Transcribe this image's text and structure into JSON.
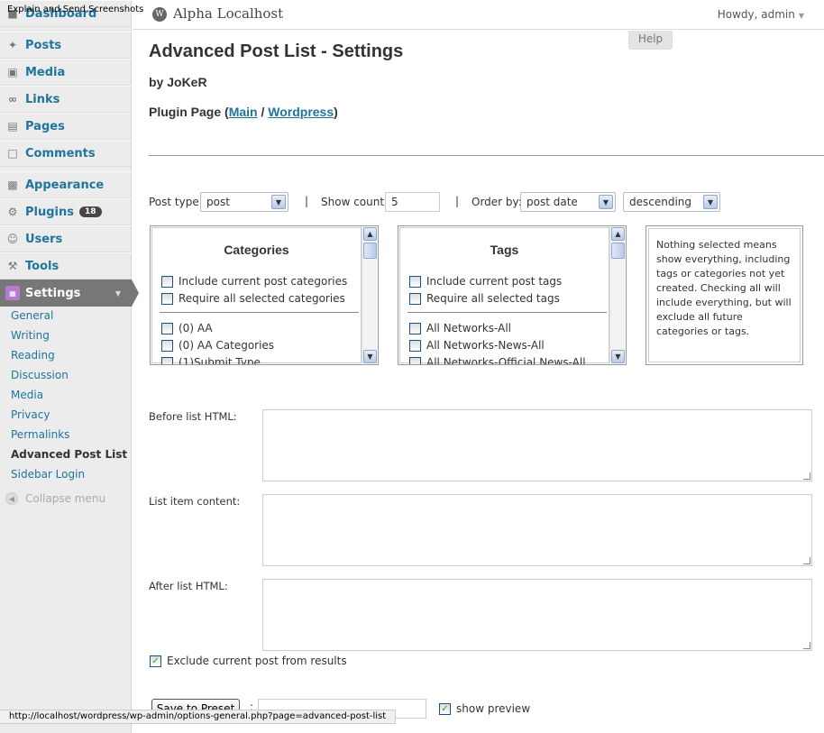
{
  "window": {
    "tooltip": "Explain and Send Screenshots",
    "status_url": "http://localhost/wordpress/wp-admin/options-general.php?page=advanced-post-list"
  },
  "header": {
    "site_title": "Alpha Localhost",
    "howdy": "Howdy, admin",
    "help": "Help"
  },
  "sidebar": {
    "items": [
      {
        "label": "Dashboard",
        "icon": "dashboard-icon"
      },
      {
        "label": "Posts",
        "icon": "pushpin-icon"
      },
      {
        "label": "Media",
        "icon": "media-icon"
      },
      {
        "label": "Links",
        "icon": "link-icon"
      },
      {
        "label": "Pages",
        "icon": "pages-icon"
      },
      {
        "label": "Comments",
        "icon": "comment-icon"
      },
      {
        "label": "Appearance",
        "icon": "appearance-icon"
      },
      {
        "label": "Plugins",
        "icon": "plugin-icon",
        "badge": "18"
      },
      {
        "label": "Users",
        "icon": "users-icon"
      },
      {
        "label": "Tools",
        "icon": "tools-icon"
      },
      {
        "label": "Settings",
        "icon": "settings-icon"
      }
    ],
    "submenu": [
      "General",
      "Writing",
      "Reading",
      "Discussion",
      "Media",
      "Privacy",
      "Permalinks",
      "Advanced Post List",
      "Sidebar Login"
    ],
    "collapse": "Collapse menu"
  },
  "page": {
    "title": "Advanced Post List - Settings",
    "byline": "by JoKeR",
    "plugin_page_prefix": "Plugin Page (",
    "link_main": "Main",
    "link_sep": " / ",
    "link_wordpress": "Wordpress",
    "plugin_page_suffix": ")"
  },
  "filters": {
    "post_type_label": "Post type:",
    "post_type_value": "post",
    "sep1": "|",
    "show_count_label": "Show count:",
    "show_count_value": "5",
    "sep2": "|",
    "order_by_label": "Order by:",
    "order_by_value": "post date",
    "order_dir_value": "descending"
  },
  "categories": {
    "title": "Categories",
    "options": [
      "Include current post categories",
      "Require all selected categories"
    ],
    "items": [
      "(0) AA",
      "(0) AA Categories",
      "(1)Submit Type"
    ]
  },
  "tags": {
    "title": "Tags",
    "options": [
      "Include current post tags",
      "Require all selected tags"
    ],
    "items": [
      "All Networks-All",
      "All Networks-News-All",
      "All Networks-Official News-All"
    ]
  },
  "note": "Nothing selected means show everything, including tags or categories not yet created. Checking all will include everything, but will exclude all future categories or tags.",
  "fields": {
    "before_list_label": "Before list HTML:",
    "list_item_label": "List item content:",
    "after_list_label": "After list HTML:"
  },
  "exclude_current_label": "Exclude current post from results",
  "exclude_current_checked": true,
  "save_preset_label": "Save to Preset",
  "preset_colon": ":",
  "show_preview_label": "show preview",
  "show_preview_checked": true
}
